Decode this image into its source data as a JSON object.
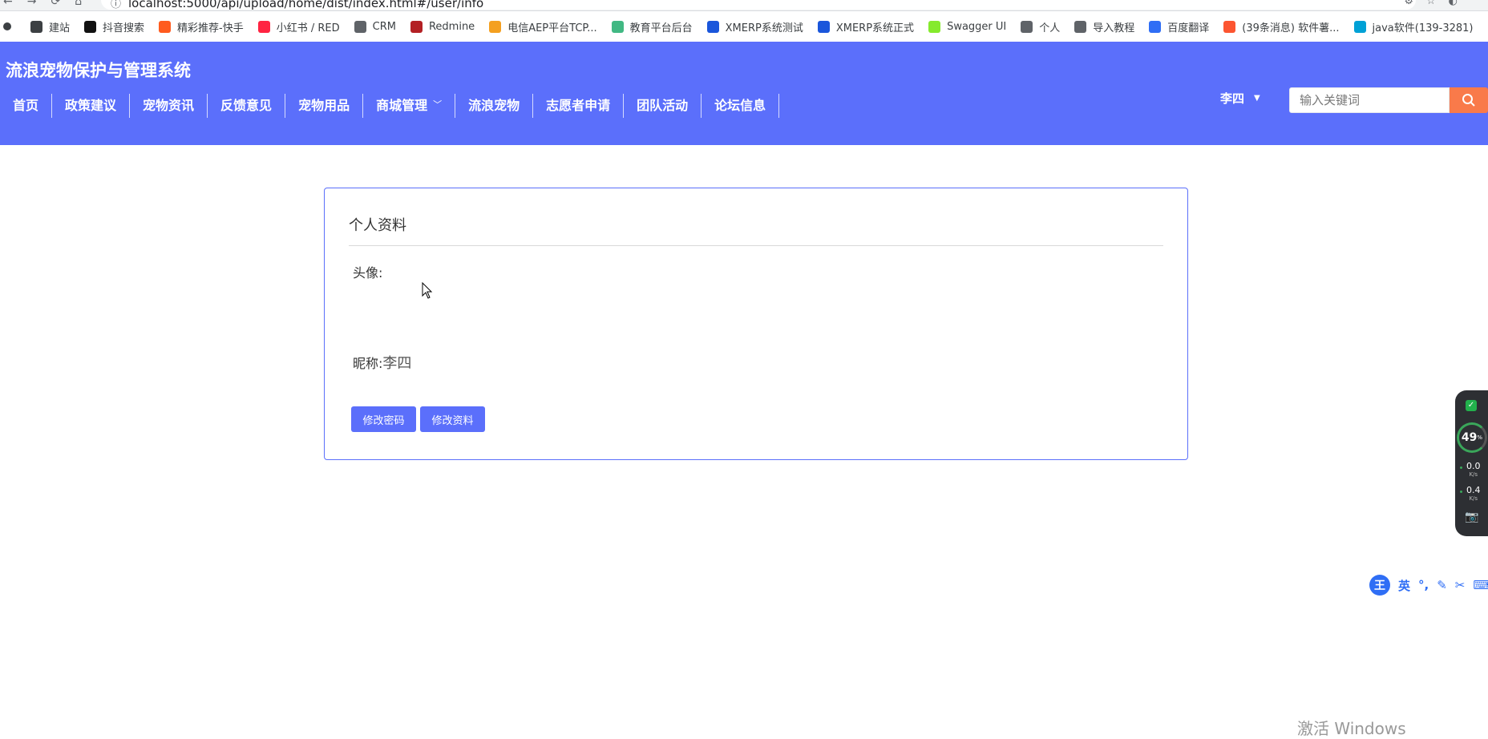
{
  "browser": {
    "url": "localhost:5000/api/upload/home/dist/index.html#/user/info",
    "bookmarks": [
      {
        "label": "建站",
        "color": "#3c4043"
      },
      {
        "label": "抖音搜索",
        "color": "#111111"
      },
      {
        "label": "精彩推荐-快手",
        "color": "#ff5b1e"
      },
      {
        "label": "小红书 / RED",
        "color": "#ff2442"
      },
      {
        "label": "CRM",
        "color": "#5f6368"
      },
      {
        "label": "Redmine",
        "color": "#b32024"
      },
      {
        "label": "电信AEP平台TCP...",
        "color": "#f4a020"
      },
      {
        "label": "教育平台后台",
        "color": "#41b883"
      },
      {
        "label": "XMERP系统测试",
        "color": "#1a56db"
      },
      {
        "label": "XMERP系统正式",
        "color": "#1a56db"
      },
      {
        "label": "Swagger UI",
        "color": "#85ea2d"
      },
      {
        "label": "个人",
        "color": "#5f6368"
      },
      {
        "label": "导入教程",
        "color": "#5f6368"
      },
      {
        "label": "百度翻译",
        "color": "#2f6ef5"
      },
      {
        "label": "(39条消息) 软件薯...",
        "color": "#fc5531"
      },
      {
        "label": "java软件(139-3281)",
        "color": "#00a1d6"
      }
    ]
  },
  "header": {
    "site_title": "流浪宠物保护与管理系统",
    "nav": [
      {
        "label": "首页"
      },
      {
        "label": "政策建议"
      },
      {
        "label": "宠物资讯"
      },
      {
        "label": "反馈意见"
      },
      {
        "label": "宠物用品"
      },
      {
        "label": "商城管理",
        "has_dropdown": true
      },
      {
        "label": "流浪宠物"
      },
      {
        "label": "志愿者申请"
      },
      {
        "label": "团队活动"
      },
      {
        "label": "论坛信息"
      }
    ],
    "user_name": "李四",
    "search_placeholder": "输入关键词",
    "accent": "#5b6ffb",
    "search_button_color": "#f97a4a"
  },
  "profile": {
    "title": "个人资料",
    "avatar_label": "头像:",
    "nickname_label": "昵称:",
    "nickname_value": "李四",
    "buttons": {
      "change_password": "修改密码",
      "edit_profile": "修改资料"
    }
  },
  "widget": {
    "percent": "49",
    "percent_unit": "%",
    "up_speed": "0.0",
    "down_speed": "0.4",
    "speed_unit": "K/s"
  },
  "ime": {
    "logo": "王",
    "mode": "英"
  },
  "watermark": "激活 Windows"
}
